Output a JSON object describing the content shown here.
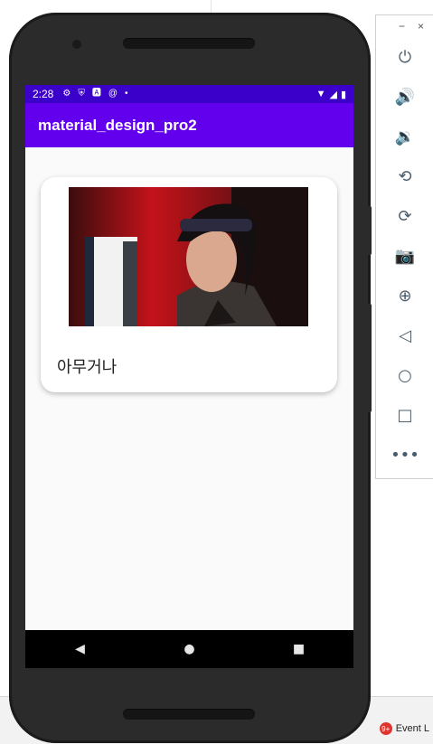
{
  "status_bar": {
    "time": "2:28",
    "icons": [
      "gear-icon",
      "shield-icon",
      "a-box-icon",
      "at-icon",
      "dot-icon"
    ],
    "right_icons": [
      "wifi-icon",
      "signal-icon",
      "battery-icon"
    ]
  },
  "app_bar": {
    "title": "material_design_pro2"
  },
  "card": {
    "caption": "아무거나",
    "image": "portrait-photo"
  },
  "nav_bar": {
    "back": "◀",
    "home": "●",
    "recents": "■"
  },
  "emulator_panel": {
    "minimize": "−",
    "close": "×",
    "tools": [
      {
        "name": "power-icon",
        "glyph": "⏻"
      },
      {
        "name": "volume-up-icon",
        "glyph": "🔊"
      },
      {
        "name": "volume-down-icon",
        "glyph": "🔉"
      },
      {
        "name": "rotate-left-icon",
        "glyph": "⟲"
      },
      {
        "name": "rotate-right-icon",
        "glyph": "⟳"
      },
      {
        "name": "camera-icon",
        "glyph": "📷"
      },
      {
        "name": "zoom-icon",
        "glyph": "⊕"
      },
      {
        "name": "back-icon",
        "glyph": "◁"
      },
      {
        "name": "home-icon",
        "glyph": "○"
      },
      {
        "name": "overview-icon",
        "glyph": "□"
      },
      {
        "name": "more-icon",
        "glyph": "•••"
      }
    ]
  },
  "ide": {
    "event_log_label": "Event L",
    "event_log_badge": "9+"
  }
}
